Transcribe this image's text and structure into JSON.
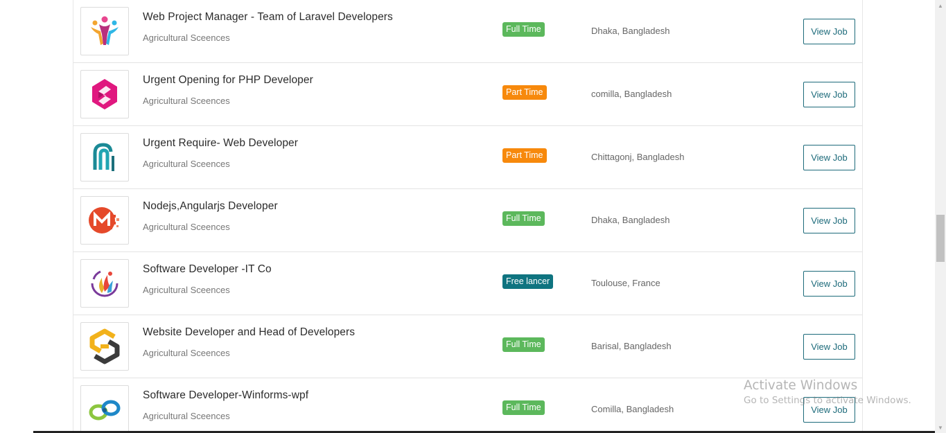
{
  "jobs": [
    {
      "title": "Web Project Manager - Team of Laravel Developers",
      "company": "Agricultural Sceences",
      "type": "Full Time",
      "type_color": "#5cb85c",
      "location": "Dhaka, Bangladesh",
      "button": "View Job",
      "logo": "people-logo-icon"
    },
    {
      "title": "Urgent Opening for PHP Developer",
      "company": "Agricultural Sceences",
      "type": "Part Time",
      "type_color": "#f7890c",
      "location": "comilla, Bangladesh",
      "button": "View Job",
      "logo": "s-hexagon-logo-icon"
    },
    {
      "title": "Urgent Require- Web Developer",
      "company": "Agricultural Sceences",
      "type": "Part Time",
      "type_color": "#f7890c",
      "location": "Chittagonj, Bangladesh",
      "button": "View Job",
      "logo": "arch-logo-icon"
    },
    {
      "title": "Nodejs,Angularjs Developer",
      "company": "Agricultural Sceences",
      "type": "Full Time",
      "type_color": "#5cb85c",
      "location": "Dhaka, Bangladesh",
      "button": "View Job",
      "logo": "m-circle-logo-icon"
    },
    {
      "title": "Software Developer -IT Co",
      "company": "Agricultural Sceences",
      "type": "Free lancer",
      "type_color": "#0f7480",
      "location": "Toulouse, France",
      "button": "View Job",
      "logo": "flame-circle-logo-icon"
    },
    {
      "title": "Website Developer and Head of Developers",
      "company": "Agricultural Sceences",
      "type": "Full Time",
      "type_color": "#5cb85c",
      "location": "Barisal, Bangladesh",
      "button": "View Job",
      "logo": "hex-s-logo-icon"
    },
    {
      "title": "Software Developer-Winforms-wpf",
      "company": "Agricultural Sceences",
      "type": "Full Time",
      "type_color": "#5cb85c",
      "location": "Comilla, Bangladesh",
      "button": "View Job",
      "logo": "infinity-logo-icon"
    }
  ],
  "watermark": {
    "title": "Activate Windows",
    "subtitle": "Go to Settings to activate Windows."
  }
}
